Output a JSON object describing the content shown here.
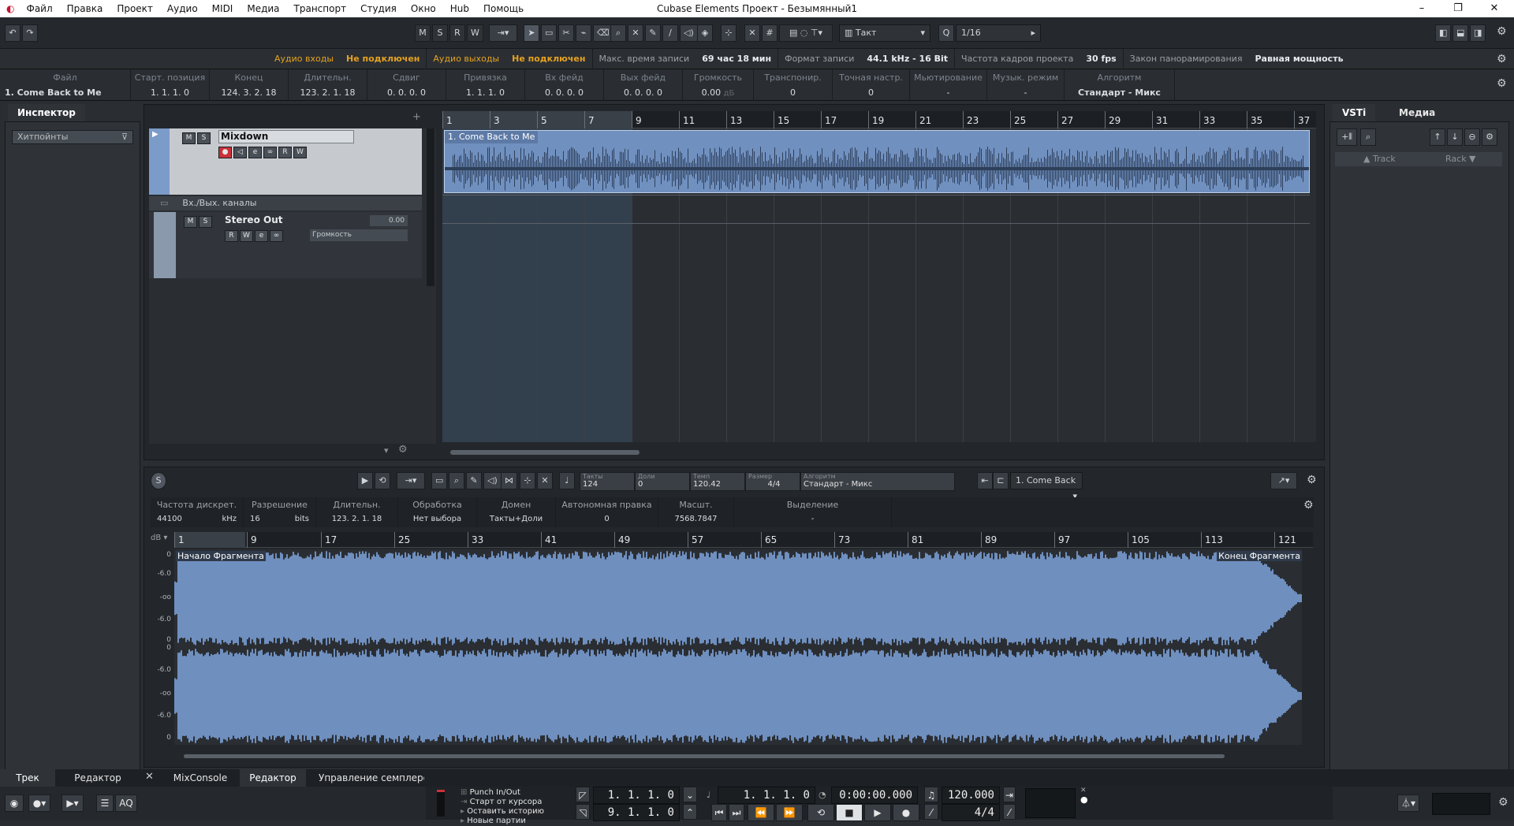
{
  "app": {
    "title": "Cubase Elements Проект - Безымянный1",
    "menu": [
      "Файл",
      "Правка",
      "Проект",
      "Аудио",
      "MIDI",
      "Медиа",
      "Транспорт",
      "Студия",
      "Окно",
      "Hub",
      "Помощь"
    ],
    "window_controls": {
      "minimize": "–",
      "restore": "❐",
      "close": "✕"
    }
  },
  "toolbar": {
    "undo": "↶",
    "redo": "↷",
    "msrw": [
      "M",
      "S",
      "R",
      "W"
    ],
    "grid_type": "Такт",
    "quantize": "1/16",
    "quantize_letter": "Q"
  },
  "status": {
    "audio_in_label": "Аудио входы",
    "audio_in_value": "Не подключен",
    "audio_out_label": "Аудио выходы",
    "audio_out_value": "Не подключен",
    "max_rec_label": "Макс. время записи",
    "max_rec_value": "69 час 18 мин",
    "rec_format_label": "Формат записи",
    "rec_format_value": "44.1 kHz - 16 Bit",
    "framerate_label": "Частота кадров проекта",
    "framerate_value": "30 fps",
    "pan_label": "Закон панорамирования",
    "pan_value": "Равная мощность"
  },
  "infoline": {
    "cols": [
      {
        "label": "Файл",
        "value": "1. Come Back to Me"
      },
      {
        "label": "Старт. позиция",
        "value": "1. 1. 1.   0"
      },
      {
        "label": "Конец",
        "value": "124. 3. 2. 18"
      },
      {
        "label": "Длительн.",
        "value": "123. 2. 1. 18"
      },
      {
        "label": "Сдвиг",
        "value": "0. 0. 0.   0"
      },
      {
        "label": "Привязка",
        "value": "1. 1. 1.   0"
      },
      {
        "label": "Вх фейд",
        "value": "0. 0. 0.   0"
      },
      {
        "label": "Вых фейд",
        "value": "0. 0. 0.   0"
      },
      {
        "label": "Громкость",
        "value": "0.00",
        "unit": "дБ"
      },
      {
        "label": "Транспонир.",
        "value": "0"
      },
      {
        "label": "Точная настр.",
        "value": "0"
      },
      {
        "label": "Мьютирование",
        "value": "-"
      },
      {
        "label": "Музык. режим",
        "value": "-"
      },
      {
        "label": "Алгоритм",
        "value": "Стандарт - Микс"
      }
    ]
  },
  "inspector": {
    "tab": "Инспектор",
    "hitpoints": "Хитпойнты"
  },
  "tracks": {
    "mixdown": {
      "name": "Mixdown",
      "m": "M",
      "s": "S",
      "r": "R",
      "w": "W"
    },
    "folder": "Вх./Вых. каналы",
    "stereo_out": {
      "name": "Stereo Out",
      "value": "0.00",
      "param": "Громкость",
      "m": "M",
      "s": "S",
      "r": "R",
      "w": "W"
    }
  },
  "ruler": {
    "marks": [
      "1",
      "3",
      "5",
      "7",
      "9",
      "11",
      "13",
      "15",
      "17",
      "19",
      "21",
      "23",
      "25",
      "27",
      "29",
      "31",
      "33",
      "35",
      "37"
    ]
  },
  "event": {
    "name": "1. Come Back to Me"
  },
  "editor": {
    "tempo_fields": [
      {
        "label": "Такты",
        "value": "124"
      },
      {
        "label": "Доли",
        "value": "0"
      },
      {
        "label": "Темп",
        "value": "120.42"
      },
      {
        "label": "Размер",
        "value": "4/4"
      },
      {
        "label": "Алгоритм",
        "value": "Стандарт - Микс"
      }
    ],
    "clip": "1. Come Back",
    "info": [
      {
        "label": "Частота дискрет.",
        "value": "44100",
        "unit": "kHz"
      },
      {
        "label": "Разрешение",
        "value": "16",
        "unit": "bits"
      },
      {
        "label": "Длительн.",
        "value": "123. 2. 1. 18"
      },
      {
        "label": "Обработка",
        "value": "Нет выбора"
      },
      {
        "label": "Домен",
        "value": "Такты+Доли"
      },
      {
        "label": "Автономная правка",
        "value": "0"
      },
      {
        "label": "Масшт.",
        "value": "7568.7847"
      },
      {
        "label": "Выделение",
        "value": "-"
      }
    ],
    "ruler": [
      "1",
      "9",
      "17",
      "25",
      "33",
      "41",
      "49",
      "57",
      "65",
      "73",
      "81",
      "89",
      "97",
      "105",
      "113",
      "121"
    ],
    "db": "dB",
    "db_scale": [
      "0",
      "-6.0",
      "-oo",
      "-6.0",
      "0",
      "0",
      "-6.0",
      "-oo",
      "-6.0",
      "0"
    ],
    "start": "Начало Фрагмента",
    "end": "Конец Фрагмента"
  },
  "right": {
    "tab_vsti": "VSTi",
    "tab_media": "Медиа",
    "track": "Track",
    "rack": "Rack"
  },
  "bottom_tabs": {
    "track": "Трек",
    "editor": "Редактор",
    "mixconsole": "MixConsole",
    "editor2": "Редактор",
    "sampler": "Управление семплером"
  },
  "transport": {
    "punch": "Punch In/Out",
    "cursor": "Старт от курсора",
    "history": "Оставить историю",
    "parts": "Новые партии",
    "left_locator": "1. 1. 1.   0",
    "right_locator": "9. 1. 1.   0",
    "position": "1. 1. 1.   0",
    "time": "0:00:00.000",
    "tempo": "120.000",
    "signature": "4/4",
    "aq": "AQ"
  },
  "colors": {
    "accent": "#e6a21e",
    "wave": "#6f8fbf",
    "bg": "#2a2e33"
  }
}
